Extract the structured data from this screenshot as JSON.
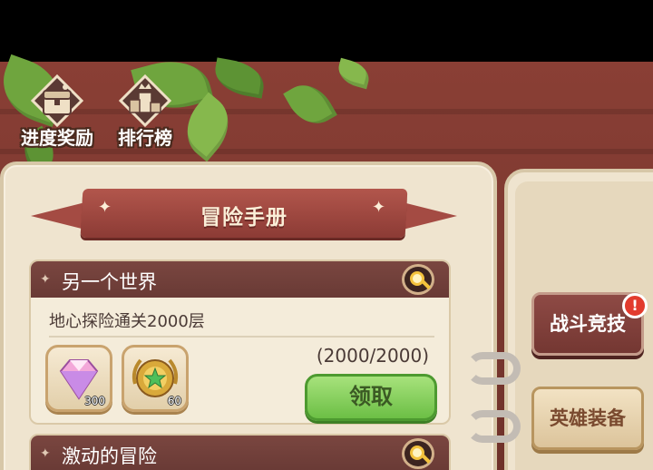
{
  "top_buttons": {
    "progress_reward": {
      "label": "进度奖励",
      "icon": "treasure-chest-icon"
    },
    "leaderboard": {
      "label": "排行榜",
      "icon": "podium-icon"
    }
  },
  "banner": {
    "title": "冒险手册"
  },
  "quests": [
    {
      "name": "另一个世界",
      "task": "地心探险通关2000层",
      "progress": "(2000/2000)",
      "rewards": [
        {
          "icon": "diamond-gem-icon",
          "count": "300"
        },
        {
          "icon": "laurel-medal-icon",
          "count": "60"
        }
      ],
      "claim_label": "领取"
    },
    {
      "name": "激动的冒险"
    }
  ],
  "side_tabs": {
    "battle": {
      "label": "战斗竞技",
      "alert": "!"
    },
    "hero": {
      "label": "英雄装备"
    }
  },
  "colors": {
    "wood": "#7b3830",
    "paper": "#efe4cf",
    "card_header": "#7a4640",
    "claim_green": "#6cbf45",
    "alert_red": "#e23b2e"
  }
}
